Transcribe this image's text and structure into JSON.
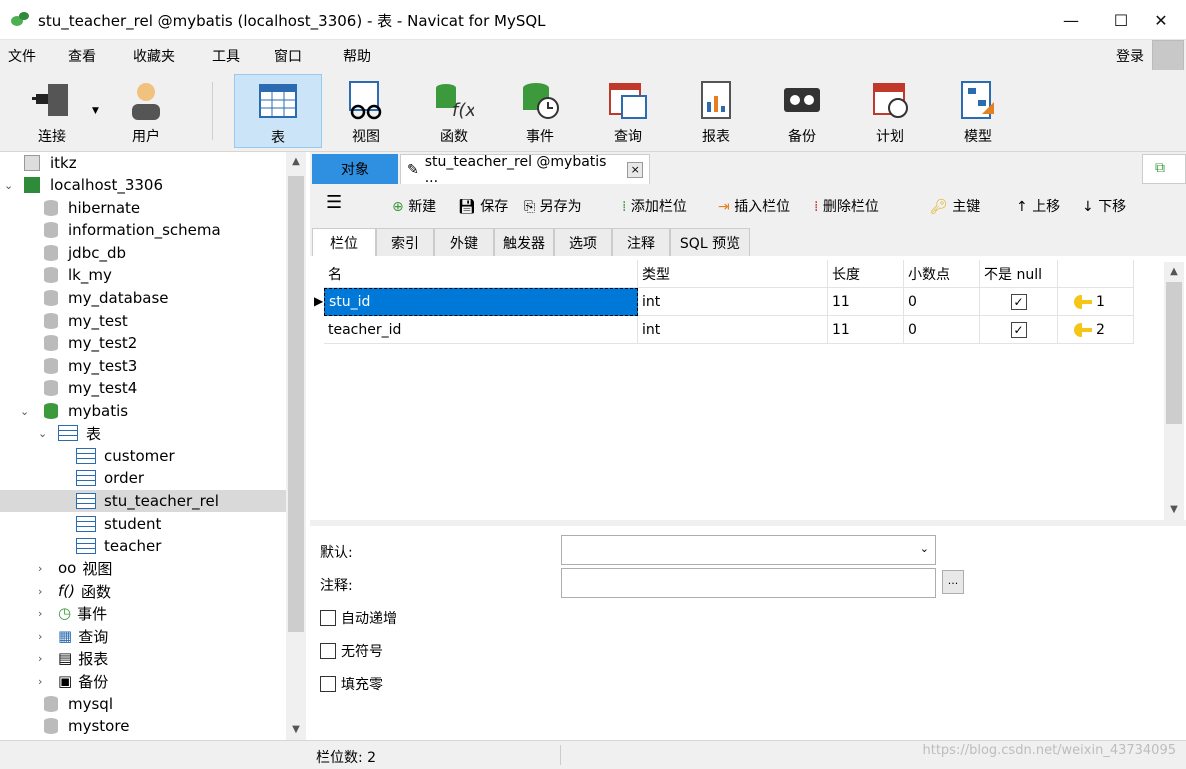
{
  "window": {
    "title": "stu_teacher_rel @mybatis (localhost_3306) - 表 - Navicat for MySQL",
    "minimize": "—",
    "maximize": "☐",
    "close": "✕"
  },
  "menu": {
    "items": [
      "文件",
      "查看",
      "收藏夹",
      "工具",
      "窗口",
      "帮助"
    ],
    "login": "登录"
  },
  "toolbar": {
    "items": [
      {
        "label": "连接",
        "icon": "connection-icon"
      },
      {
        "label": "用户",
        "icon": "user-icon"
      },
      {
        "label": "表",
        "icon": "table-icon"
      },
      {
        "label": "视图",
        "icon": "view-icon"
      },
      {
        "label": "函数",
        "icon": "function-icon"
      },
      {
        "label": "事件",
        "icon": "event-icon"
      },
      {
        "label": "查询",
        "icon": "query-icon"
      },
      {
        "label": "报表",
        "icon": "report-icon"
      },
      {
        "label": "备份",
        "icon": "backup-icon"
      },
      {
        "label": "计划",
        "icon": "schedule-icon"
      },
      {
        "label": "模型",
        "icon": "model-icon"
      }
    ],
    "active": "表"
  },
  "sidebar": {
    "items": [
      {
        "label": "itkz"
      },
      {
        "label": "localhost_3306"
      },
      {
        "label": "hibernate"
      },
      {
        "label": "information_schema"
      },
      {
        "label": "jdbc_db"
      },
      {
        "label": "lk_my"
      },
      {
        "label": "my_database"
      },
      {
        "label": "my_test"
      },
      {
        "label": "my_test2"
      },
      {
        "label": "my_test3"
      },
      {
        "label": "my_test4"
      },
      {
        "label": "mybatis"
      },
      {
        "label": "表"
      },
      {
        "label": "customer"
      },
      {
        "label": "order"
      },
      {
        "label": "stu_teacher_rel"
      },
      {
        "label": "student"
      },
      {
        "label": "teacher"
      },
      {
        "label": "视图"
      },
      {
        "label": "函数"
      },
      {
        "label": "事件"
      },
      {
        "label": "查询"
      },
      {
        "label": "报表"
      },
      {
        "label": "备份"
      },
      {
        "label": "mysql"
      },
      {
        "label": "mystore"
      }
    ],
    "selected": "stu_teacher_rel"
  },
  "tabs": {
    "objects": "对象",
    "editor": "stu_teacher_rel @mybatis ...",
    "close": "×"
  },
  "editor_toolbar": {
    "menu": "☰",
    "new": "新建",
    "save": "保存",
    "save_as": "另存为",
    "add_field": "添加栏位",
    "insert_field": "插入栏位",
    "delete_field": "删除栏位",
    "primary_key": "主键",
    "move_up": "上移",
    "move_down": "下移"
  },
  "subtabs": [
    "栏位",
    "索引",
    "外键",
    "触发器",
    "选项",
    "注释",
    "SQL 预览"
  ],
  "grid": {
    "headers": [
      "名",
      "类型",
      "长度",
      "小数点",
      "不是 null",
      ""
    ],
    "rows": [
      {
        "name": "stu_id",
        "type": "int",
        "length": "11",
        "decimals": "0",
        "not_null": "✓",
        "key": "1"
      },
      {
        "name": "teacher_id",
        "type": "int",
        "length": "11",
        "decimals": "0",
        "not_null": "✓",
        "key": "2"
      }
    ]
  },
  "properties": {
    "default_label": "默认:",
    "comment_label": "注释:",
    "ellipsis": "...",
    "auto_increment": "自动递增",
    "unsigned": "无符号",
    "zerofill": "填充零"
  },
  "status": {
    "field_count": "栏位数: 2",
    "watermark": "https://blog.csdn.net/weixin_43734095"
  }
}
